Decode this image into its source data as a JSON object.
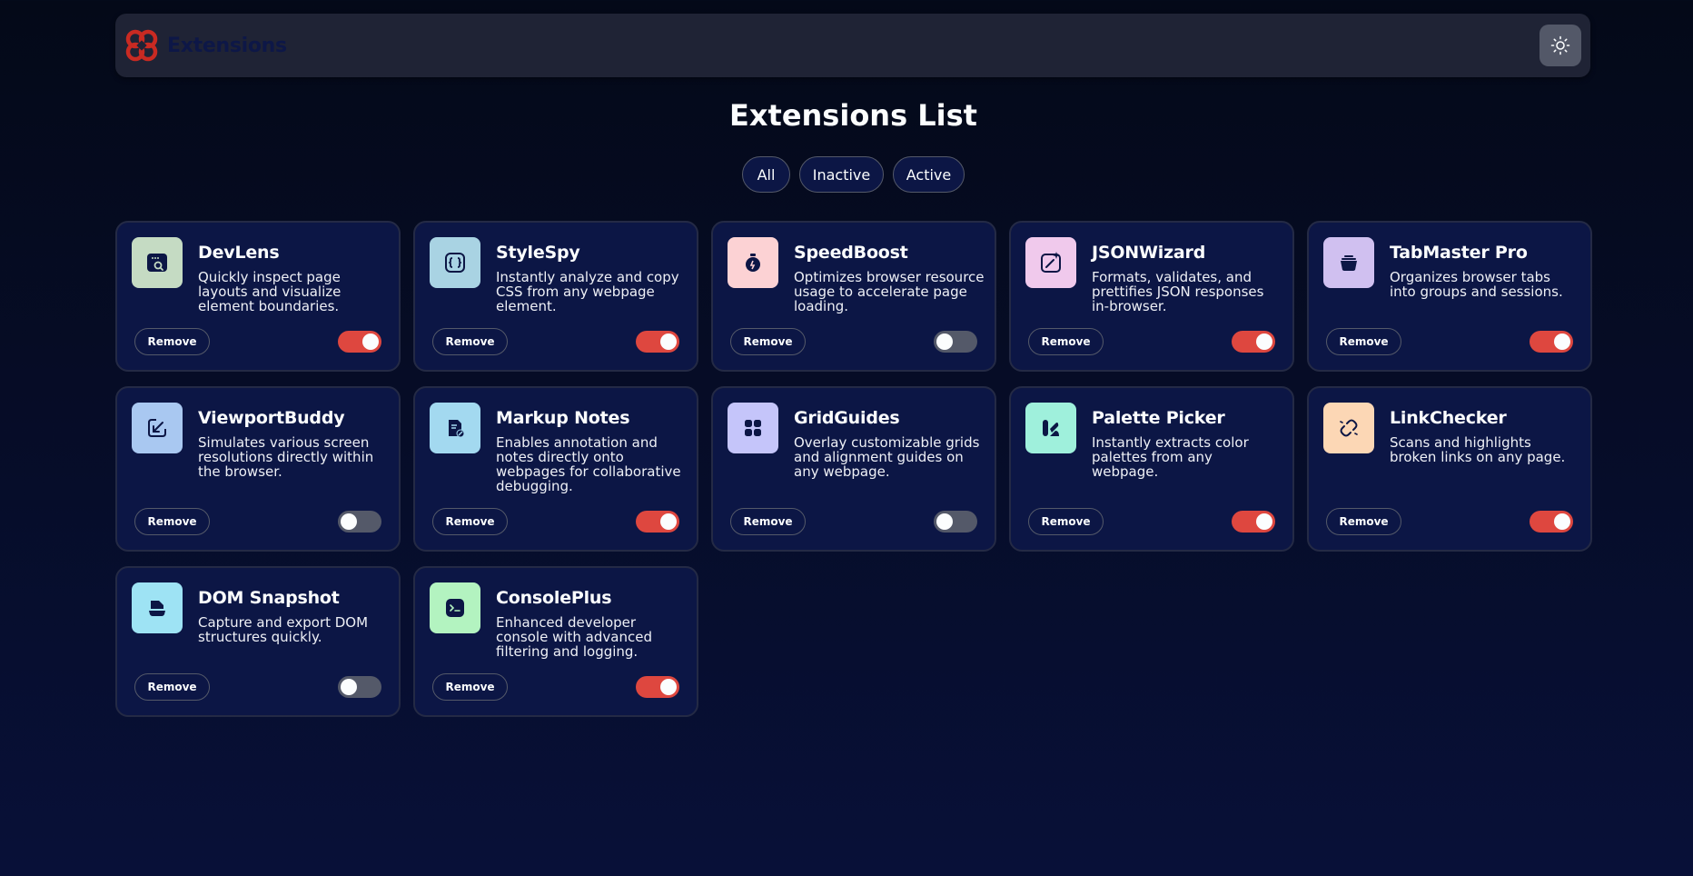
{
  "header": {
    "brand": "Extensions",
    "logo_icon": "extensions-logo-icon",
    "theme_toggle_icon": "sun-icon"
  },
  "title": "Extensions List",
  "filters": [
    {
      "label": "All",
      "selected": true
    },
    {
      "label": "Inactive",
      "selected": false
    },
    {
      "label": "Active",
      "selected": false
    }
  ],
  "remove_label": "Remove",
  "extensions": [
    {
      "name": "DevLens",
      "description": "Quickly inspect page layouts and visualize element boundaries.",
      "active": true,
      "icon": "devlens-icon",
      "icon_bg": "#c5dbc3"
    },
    {
      "name": "StyleSpy",
      "description": "Instantly analyze and copy CSS from any webpage element.",
      "active": true,
      "icon": "stylespy-icon",
      "icon_bg": "#a9d3e3"
    },
    {
      "name": "SpeedBoost",
      "description": "Optimizes browser resource usage to accelerate page loading.",
      "active": false,
      "icon": "speedboost-icon",
      "icon_bg": "#fcd2d4"
    },
    {
      "name": "JSONWizard",
      "description": "Formats, validates, and prettifies JSON responses in-browser.",
      "active": true,
      "icon": "jsonwizard-icon",
      "icon_bg": "#f0c9ec"
    },
    {
      "name": "TabMaster Pro",
      "description": "Organizes browser tabs into groups and sessions.",
      "active": true,
      "icon": "tabmaster-icon",
      "icon_bg": "#d0c0f0"
    },
    {
      "name": "ViewportBuddy",
      "description": "Simulates various screen resolutions directly within the browser.",
      "active": false,
      "icon": "viewportbuddy-icon",
      "icon_bg": "#a9c8f1"
    },
    {
      "name": "Markup Notes",
      "description": "Enables annotation and notes directly onto webpages for collaborative debugging.",
      "active": true,
      "icon": "markupnotes-icon",
      "icon_bg": "#a3d9f0"
    },
    {
      "name": "GridGuides",
      "description": "Overlay customizable grids and alignment guides on any webpage.",
      "active": false,
      "icon": "gridguides-icon",
      "icon_bg": "#c5c5fa"
    },
    {
      "name": "Palette Picker",
      "description": "Instantly extracts color palettes from any webpage.",
      "active": true,
      "icon": "palettepicker-icon",
      "icon_bg": "#9ff0dc"
    },
    {
      "name": "LinkChecker",
      "description": "Scans and highlights broken links on any page.",
      "active": true,
      "icon": "linkchecker-icon",
      "icon_bg": "#fcd7b5"
    },
    {
      "name": "DOM Snapshot",
      "description": "Capture and export DOM structures quickly.",
      "active": false,
      "icon": "domsnapshot-icon",
      "icon_bg": "#9ee3f4"
    },
    {
      "name": "ConsolePlus",
      "description": "Enhanced developer console with advanced filtering and logging.",
      "active": true,
      "icon": "consoleplus-icon",
      "icon_bg": "#b3f3c0"
    }
  ],
  "colors": {
    "accent_red": "#de473f",
    "card_bg": "#0c1645",
    "page_bg": "#081038",
    "toggle_off": "#545969"
  }
}
